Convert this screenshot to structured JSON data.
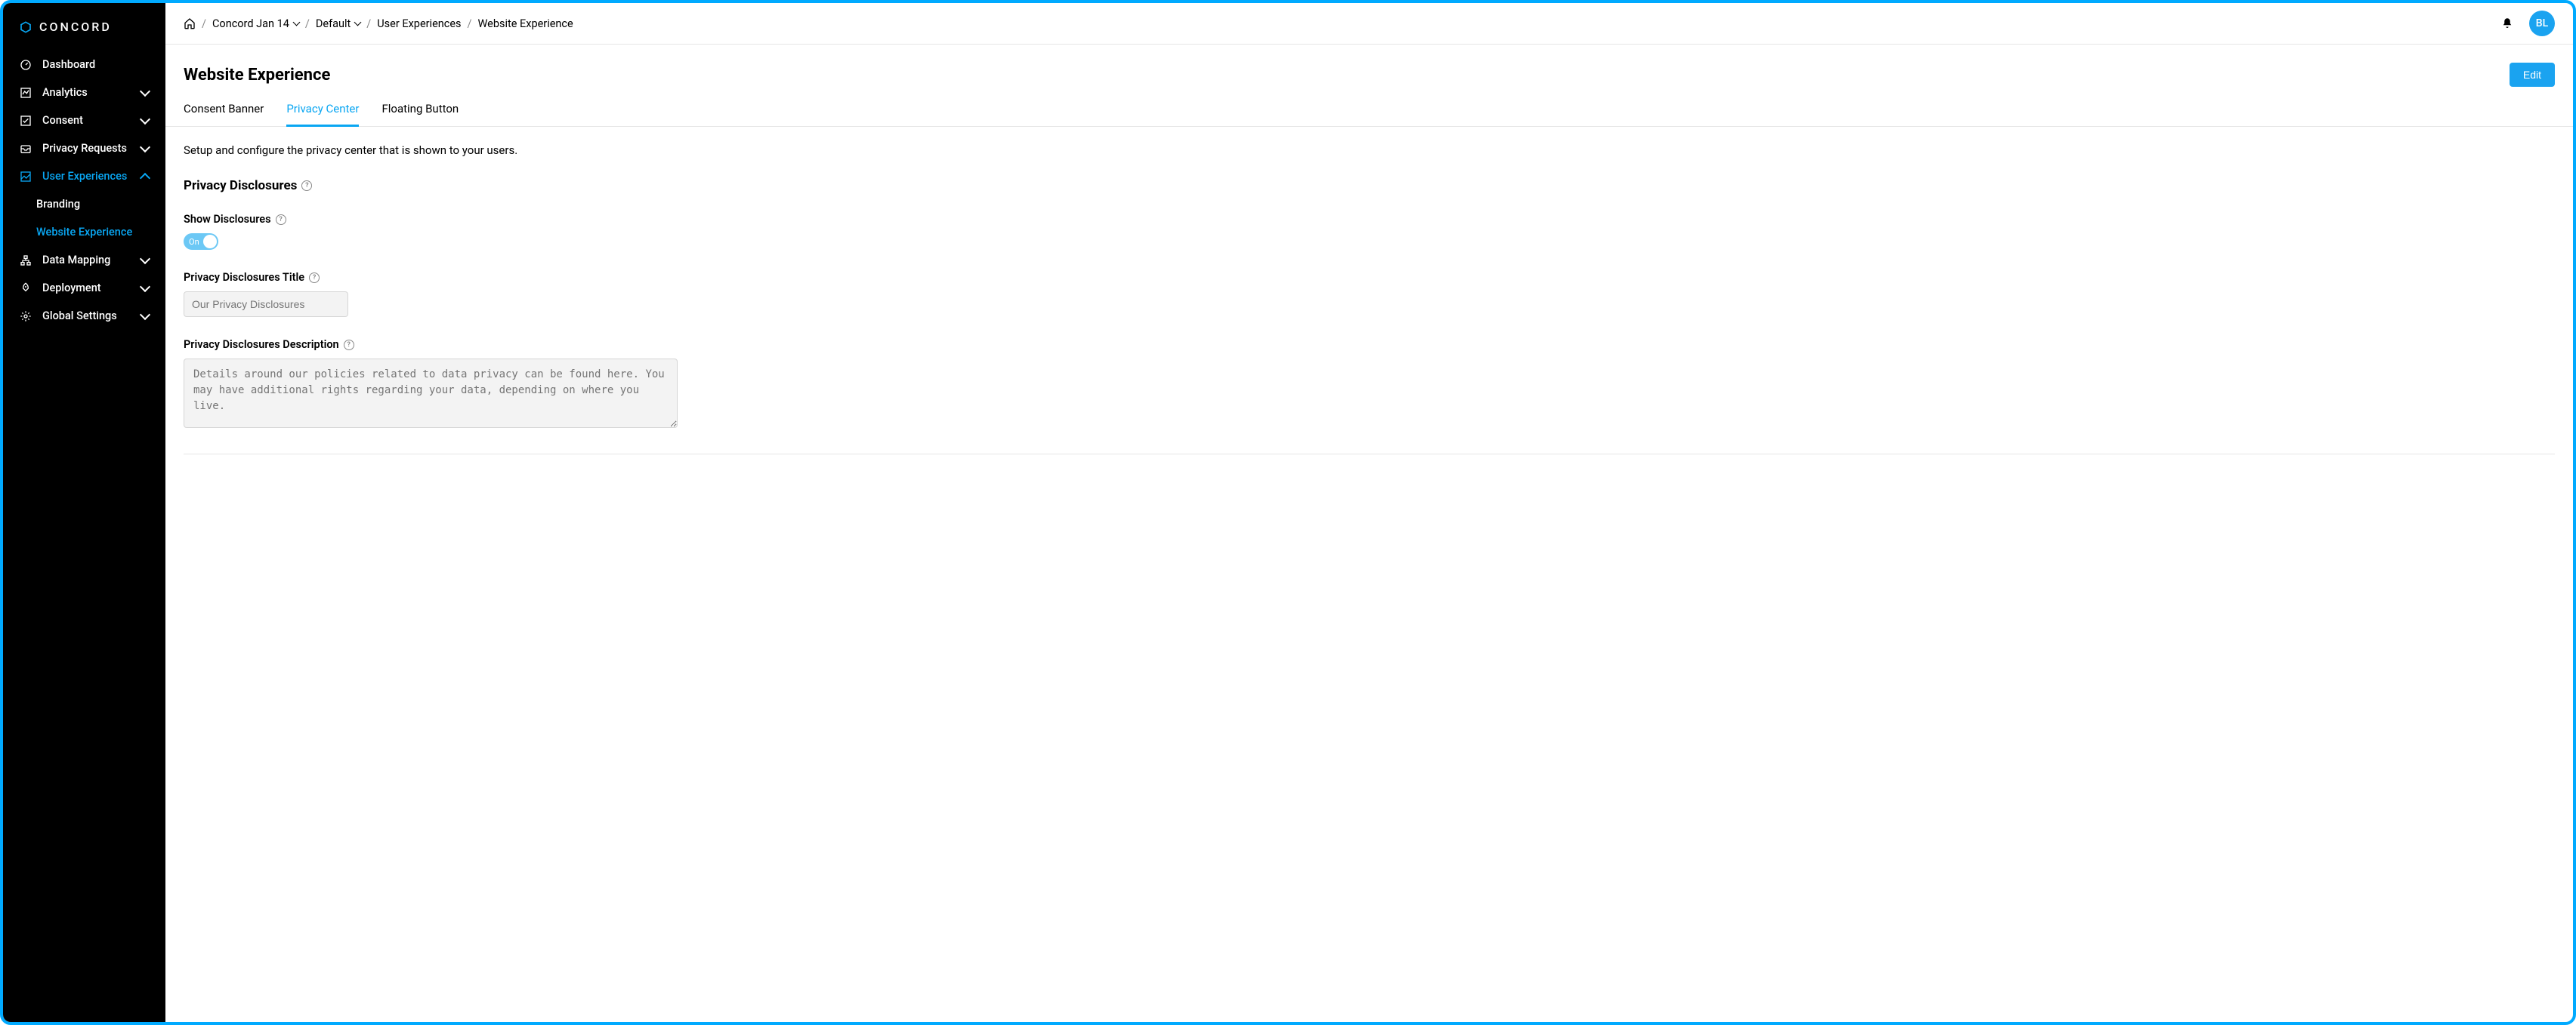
{
  "brand": {
    "name": "CONCORD"
  },
  "sidebar": {
    "items": [
      {
        "label": "Dashboard"
      },
      {
        "label": "Analytics"
      },
      {
        "label": "Consent"
      },
      {
        "label": "Privacy Requests"
      },
      {
        "label": "User Experiences"
      },
      {
        "label": "Data Mapping"
      },
      {
        "label": "Deployment"
      },
      {
        "label": "Global Settings"
      }
    ],
    "sub": {
      "branding": "Branding",
      "website_experience": "Website Experience"
    }
  },
  "breadcrumbs": {
    "items": [
      {
        "label": "Concord Jan 14"
      },
      {
        "label": "Default"
      },
      {
        "label": "User Experiences"
      },
      {
        "label": "Website Experience"
      }
    ]
  },
  "user": {
    "initials": "BL"
  },
  "page": {
    "title": "Website Experience",
    "edit_label": "Edit"
  },
  "tabs": {
    "consent_banner": "Consent Banner",
    "privacy_center": "Privacy Center",
    "floating_button": "Floating Button"
  },
  "content": {
    "intro": "Setup and configure the privacy center that is shown to your users.",
    "section_title": "Privacy Disclosures",
    "show_disclosures_label": "Show Disclosures",
    "toggle_on_label": "On",
    "title_field_label": "Privacy Disclosures Title",
    "title_field_placeholder": "Our Privacy Disclosures",
    "desc_field_label": "Privacy Disclosures Description",
    "desc_field_placeholder": "Details around our policies related to data privacy can be found here. You may have additional rights regarding your data, depending on where you live."
  }
}
